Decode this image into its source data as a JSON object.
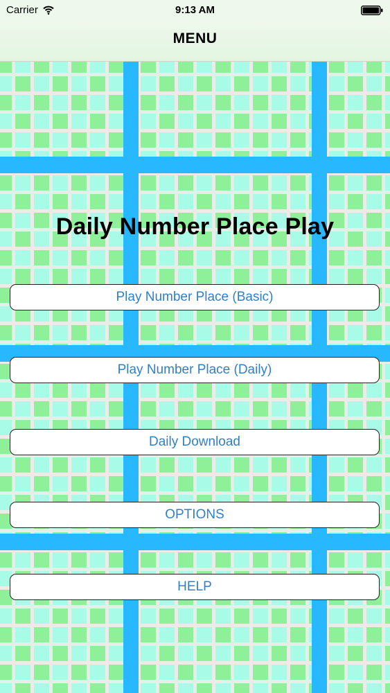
{
  "status_bar": {
    "carrier": "Carrier",
    "time": "9:13 AM",
    "icons": [
      "wifi-icon",
      "battery-icon"
    ]
  },
  "nav": {
    "title": "MENU"
  },
  "main": {
    "app_title": "Daily Number Place Play",
    "buttons": [
      {
        "label": "Play Number Place (Basic)"
      },
      {
        "label": "Play Number Place (Daily)"
      },
      {
        "label": "Daily Download"
      },
      {
        "label": "OPTIONS"
      },
      {
        "label": "HELP"
      }
    ]
  },
  "colors": {
    "grid_stripe": "#27b8ff",
    "tile_green": "#8ff09a",
    "tile_cyan": "#a8fbe6",
    "button_text": "#2f7fce"
  }
}
